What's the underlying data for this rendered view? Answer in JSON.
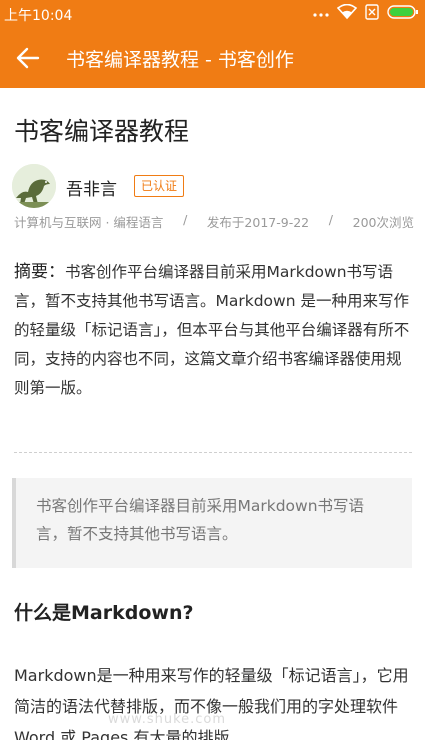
{
  "status_bar": {
    "time": "上午10:04",
    "icons": [
      "more-dots-icon",
      "wifi-icon",
      "sim-off-icon",
      "battery-icon"
    ]
  },
  "app_bar": {
    "back_icon": "arrow-left-icon",
    "title": "书客编译器教程 - 书客创作"
  },
  "article": {
    "title": "书客编译器教程",
    "author": "吾非言",
    "badge": "已认证",
    "meta": {
      "category": "计算机与互联网 · 编程语言",
      "sep1": "/",
      "date": "发布于2017-9-22",
      "sep2": "/",
      "views": "200次浏览"
    },
    "summary_label": "摘要：",
    "summary_text": "书客创作平台编译器目前采用Markdown书写语言，暂不支持其他书写语言。Markdown 是一种用来写作的轻量级「标记语言」，但本平台与其他平台编译器有所不同，支持的内容也不同，这篇文章介绍书客编译器使用规则第一版。",
    "quote": "书客创作平台编译器目前采用Markdown书写语言，暂不支持其他书写语言。",
    "section_heading": "什么是Markdown?",
    "body": "Markdown是一种用来写作的轻量级「标记语言」，它用简洁的语法代替排版，而不像一般我们用的字处理软件 Word 或 Pages 有大量的排版",
    "watermark": "www.shuke.com"
  },
  "colors": {
    "accent": "#f07c14",
    "text": "#222222",
    "meta": "#9a9a9a",
    "quote_bg": "#f4f4f4"
  }
}
